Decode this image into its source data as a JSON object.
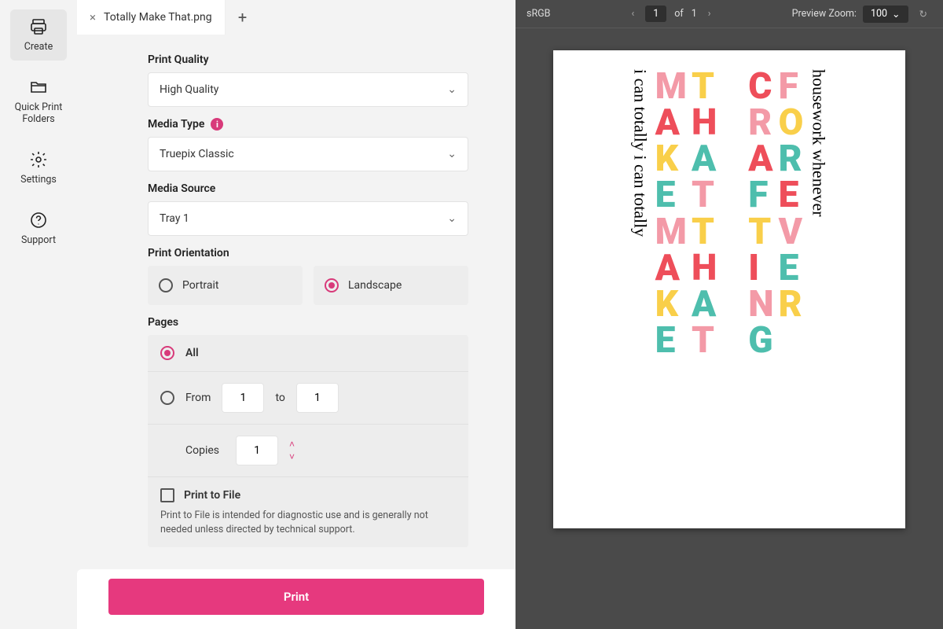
{
  "sidebar": {
    "items": [
      {
        "label": "Create"
      },
      {
        "label": "Quick Print Folders"
      },
      {
        "label": "Settings"
      },
      {
        "label": "Support"
      }
    ]
  },
  "tab": {
    "title": "Totally Make That.png"
  },
  "form": {
    "print_quality": {
      "label": "Print Quality",
      "value": "High Quality"
    },
    "media_type": {
      "label": "Media Type",
      "value": "Truepix Classic"
    },
    "media_source": {
      "label": "Media Source",
      "value": "Tray 1"
    },
    "orientation": {
      "label": "Print Orientation",
      "portrait": "Portrait",
      "landscape": "Landscape"
    },
    "pages": {
      "label": "Pages",
      "all": "All",
      "from": "From",
      "to": "to",
      "from_val": "1",
      "to_val": "1",
      "copies_label": "Copies",
      "copies_val": "1",
      "ptf_label": "Print to File",
      "ptf_desc": "Print to File is intended for diagnostic use and is generally not needed unless directed by technical support."
    },
    "print_button": "Print"
  },
  "preview": {
    "colorspace": "sRGB",
    "page_current": "1",
    "page_sep": "of",
    "page_total": "1",
    "zoom_label": "Preview Zoom:",
    "zoom_value": "100"
  },
  "artwork": {
    "design1": {
      "script": "i can totally i can totally",
      "line1": "MAKE MAKE",
      "line2": "THAT THAT"
    },
    "design2": {
      "script": "housework whenever",
      "line1": "CRAFTING",
      "line2": "FOREVER"
    }
  }
}
